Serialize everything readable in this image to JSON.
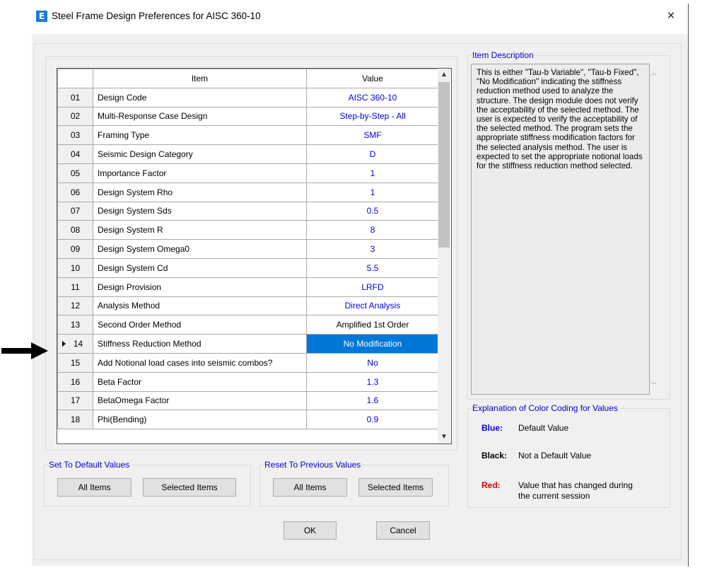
{
  "window": {
    "title": "Steel Frame Design Preferences for AISC 360-10",
    "app_icon_letter": "E",
    "close_glyph": "×"
  },
  "grid": {
    "columns": [
      "Item",
      "Value"
    ],
    "selected_row": "14",
    "rows": [
      {
        "num": "01",
        "item": "Design Code",
        "value": "AISC 360-10",
        "color": "blue"
      },
      {
        "num": "02",
        "item": "Multi-Response Case Design",
        "value": "Step-by-Step - All",
        "color": "blue"
      },
      {
        "num": "03",
        "item": "Framing Type",
        "value": "SMF",
        "color": "blue"
      },
      {
        "num": "04",
        "item": "Seismic Design Category",
        "value": "D",
        "color": "blue"
      },
      {
        "num": "05",
        "item": "Importance Factor",
        "value": "1",
        "color": "blue"
      },
      {
        "num": "06",
        "item": "Design System Rho",
        "value": "1",
        "color": "blue"
      },
      {
        "num": "07",
        "item": "Design System Sds",
        "value": "0.5",
        "color": "blue"
      },
      {
        "num": "08",
        "item": "Design System R",
        "value": "8",
        "color": "blue"
      },
      {
        "num": "09",
        "item": "Design System Omega0",
        "value": "3",
        "color": "blue"
      },
      {
        "num": "10",
        "item": "Design System Cd",
        "value": "5.5",
        "color": "blue"
      },
      {
        "num": "11",
        "item": "Design Provision",
        "value": "LRFD",
        "color": "blue"
      },
      {
        "num": "12",
        "item": "Analysis Method",
        "value": "Direct Analysis",
        "color": "blue"
      },
      {
        "num": "13",
        "item": "Second Order Method",
        "value": "Amplified 1st Order",
        "color": "black"
      },
      {
        "num": "14",
        "item": "Stiffness Reduction Method",
        "value": "No Modification",
        "color": "blue"
      },
      {
        "num": "15",
        "item": "Add Notional load cases into seismic combos?",
        "value": "No",
        "color": "blue"
      },
      {
        "num": "16",
        "item": "Beta Factor",
        "value": "1.3",
        "color": "blue"
      },
      {
        "num": "17",
        "item": "BetaOmega Factor",
        "value": "1.6",
        "color": "blue"
      },
      {
        "num": "18",
        "item": "Phi(Bending)",
        "value": "0.9",
        "color": "blue"
      }
    ]
  },
  "item_description": {
    "legend": "Item Description",
    "text": "This is either \"Tau-b Variable\", \"Tau-b Fixed\",  \"No Modification\" indicating the stiffness reduction method used to analyze the structure.  The design module does not verify the acceptability of the selected method.  The user is expected to verify the acceptability of the selected method.  The program sets the appropriate stiffness modification factors for the selected analysis method.  The user is expected to set the appropriate notional loads for the stiffness reduction method selected."
  },
  "color_coding": {
    "legend": "Explanation of Color Coding for Values",
    "blue_label": "Blue:",
    "blue_text": "Default Value",
    "black_label": "Black:",
    "black_text": "Not a Default Value",
    "red_label": "Red:",
    "red_text_1": "Value that has changed during",
    "red_text_2": "the current session",
    "colors": {
      "blue": "#0000e6",
      "black": "#000000",
      "red": "#e00000",
      "selection": "#0078d7"
    }
  },
  "set_defaults": {
    "legend": "Set To Default Values",
    "all_items": "All Items",
    "selected_items": "Selected Items"
  },
  "reset_previous": {
    "legend": "Reset To Previous Values",
    "all_items": "All Items",
    "selected_items": "Selected Items"
  },
  "buttons": {
    "ok": "OK",
    "cancel": "Cancel"
  }
}
